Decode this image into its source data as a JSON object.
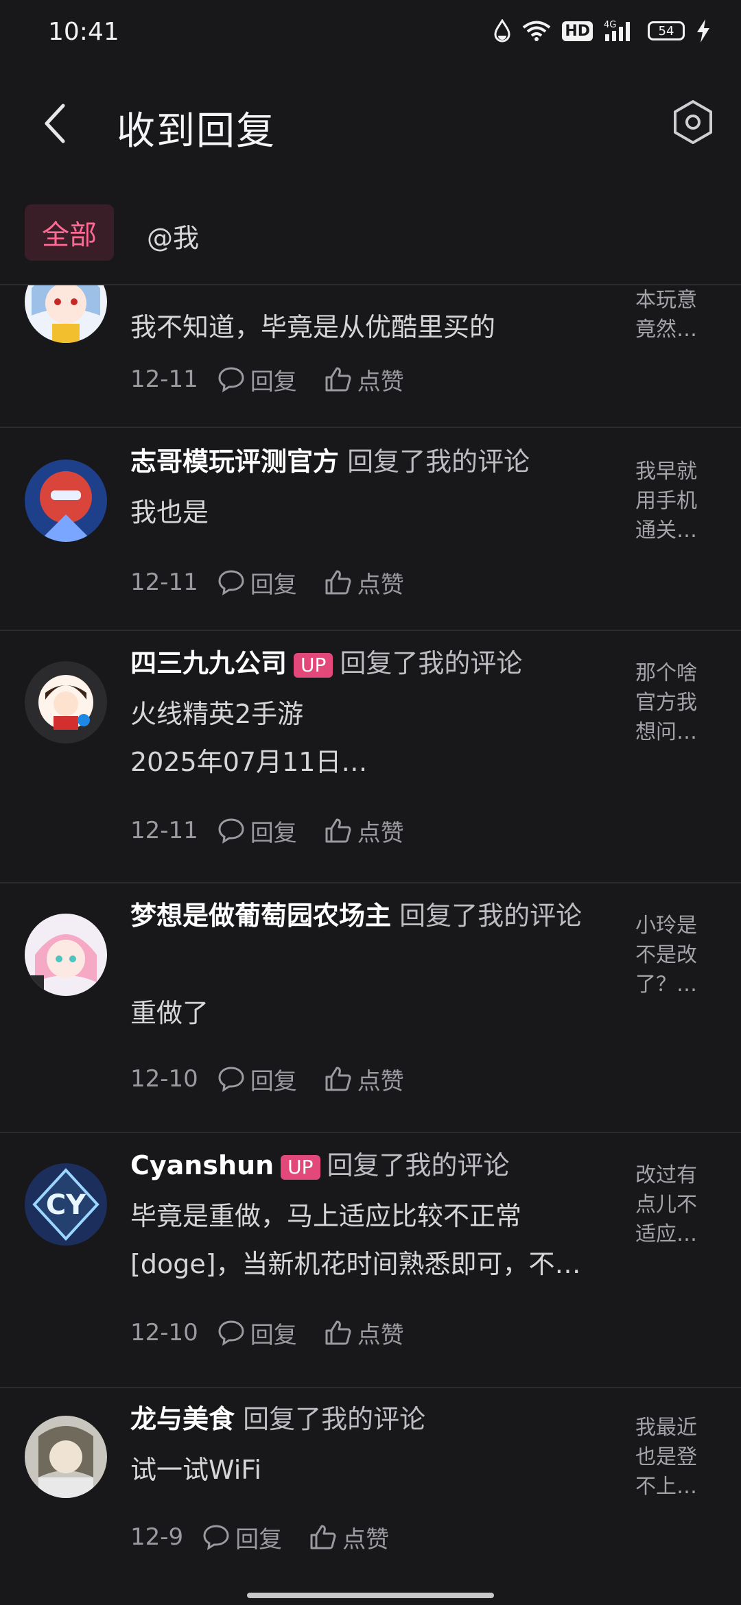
{
  "status_bar": {
    "time": "10:41",
    "network": "4G",
    "battery": "54"
  },
  "header": {
    "title": "收到回复"
  },
  "tabs": [
    {
      "label": "全部",
      "active": true
    },
    {
      "label": "@我",
      "active": false
    }
  ],
  "replies": [
    {
      "name": "",
      "up": false,
      "action": "",
      "content": [
        "我不知道，毕竟是从优酷里买的"
      ],
      "date": "12-11",
      "reply_label": "回复",
      "like_label": "点赞",
      "quote": "本玩意竟然…"
    },
    {
      "name": "志哥模玩评测官方",
      "up": false,
      "action": "回复了我的评论",
      "content": [
        "我也是"
      ],
      "date": "12-11",
      "reply_label": "回复",
      "like_label": "点赞",
      "quote": "我早就用手机通关…"
    },
    {
      "name": "四三九九公司",
      "up": true,
      "up_label": "UP",
      "action": "回复了我的评论",
      "content": [
        "火线精英2手游",
        "2025年07月11日…"
      ],
      "date": "12-11",
      "reply_label": "回复",
      "like_label": "点赞",
      "quote": "那个啥官方我想问…"
    },
    {
      "name": "梦想是做葡萄园农场主",
      "up": false,
      "action": "回复了我的评论",
      "content": [
        "重做了"
      ],
      "date": "12-10",
      "reply_label": "回复",
      "like_label": "点赞",
      "quote": "小玲是不是改了？…"
    },
    {
      "name": "Cyanshun",
      "up": true,
      "up_label": "UP",
      "action": "回复了我的评论",
      "content": [
        "毕竟是重做，马上适应比较不正常",
        "[doge]，当新机花时间熟悉即可，不…"
      ],
      "date": "12-10",
      "reply_label": "回复",
      "like_label": "点赞",
      "quote": "改过有点儿不适应…"
    },
    {
      "name": "龙与美食",
      "up": false,
      "action": "回复了我的评论",
      "content": [
        "试一试WiFi"
      ],
      "date": "12-9",
      "reply_label": "回复",
      "like_label": "点赞",
      "quote": "我最近也是登不上…"
    }
  ],
  "colors": {
    "background": "#18181b",
    "accent": "#ff6a95",
    "up_badge": "#e3487b"
  }
}
